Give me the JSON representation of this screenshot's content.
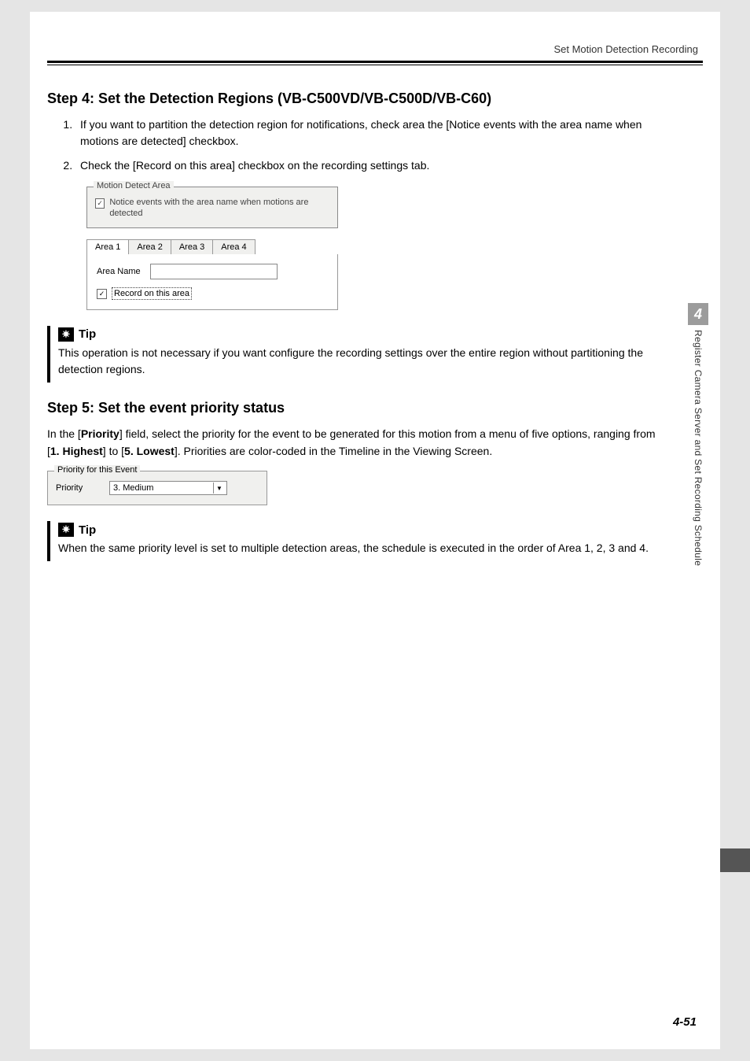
{
  "header": {
    "section_title": "Set Motion Detection Recording"
  },
  "chapter": {
    "number": "4",
    "title": "Register Camera Server and Set Recording Schedule"
  },
  "step4": {
    "heading": "Step 4: Set the Detection Regions (VB-C500VD/VB-C500D/VB-C60)",
    "item1": "If you want to partition the detection region for notifications, check area the [Notice events with the area name when motions are detected] checkbox.",
    "item2": "Check the [Record on this area] checkbox on the recording settings tab."
  },
  "motion_box": {
    "legend": "Motion Detect Area",
    "notice_label": "Notice events with the area name when motions are detected",
    "tabs": [
      "Area 1",
      "Area 2",
      "Area 3",
      "Area 4"
    ],
    "area_name_label": "Area Name",
    "record_label": "Record on this area"
  },
  "tip1": {
    "label": "Tip",
    "body": "This operation is not necessary if you want configure the recording settings over the entire region without partitioning the detection regions."
  },
  "step5": {
    "heading": "Step 5: Set the event priority status",
    "body_parts": {
      "p1a": "In the [",
      "p1b": "Priority",
      "p1c": "] field, select the priority for the event to be generated for this motion from a menu of five options, ranging from [",
      "p1d": "1. Highest",
      "p1e": "] to [",
      "p1f": "5. Lowest",
      "p1g": "]. Priorities are color-coded in the Timeline in the Viewing Screen."
    }
  },
  "priority_box": {
    "legend": "Priority for this Event",
    "label": "Priority",
    "value": "3. Medium"
  },
  "tip2": {
    "label": "Tip",
    "body": "When the same priority level is set to multiple detection areas, the schedule is executed in the order of Area 1, 2, 3 and 4."
  },
  "footer": {
    "page": "4-51"
  }
}
